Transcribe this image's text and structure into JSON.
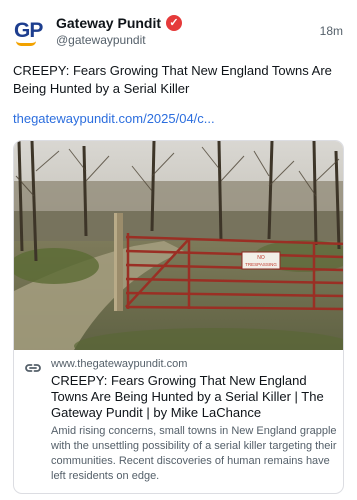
{
  "post": {
    "author_name": "Gateway Pundit",
    "handle": "@gatewaypundit",
    "time": "18m",
    "avatar_text": "GP",
    "text": "CREEPY: Fears Growing That New England Towns Are Being Hunted by a Serial Killer",
    "link_text": "thegatewaypundit.com/2025/04/c...",
    "verified_glyph": "✓"
  },
  "card": {
    "domain": "www.thegatewaypundit.com",
    "title": "CREEPY: Fears Growing That New England Towns Are Being Hunted by a Serial Killer | The Gateway Pundit | by Mike LaChance",
    "description": "Amid rising concerns, small towns in New England grapple with the unsettling possibility of a serial killer targeting their communities. Recent discoveries of human remains have left residents on edge.",
    "sign_text_line1": "NO",
    "sign_text_line2": "TRESPASSING"
  },
  "colors": {
    "link": "#2c6ede",
    "verified": "#e53a3a",
    "brand_blue": "#1d3e8f",
    "brand_orange": "#f2a200"
  },
  "icons": [
    "verified-badge-icon",
    "link-chain-icon"
  ]
}
